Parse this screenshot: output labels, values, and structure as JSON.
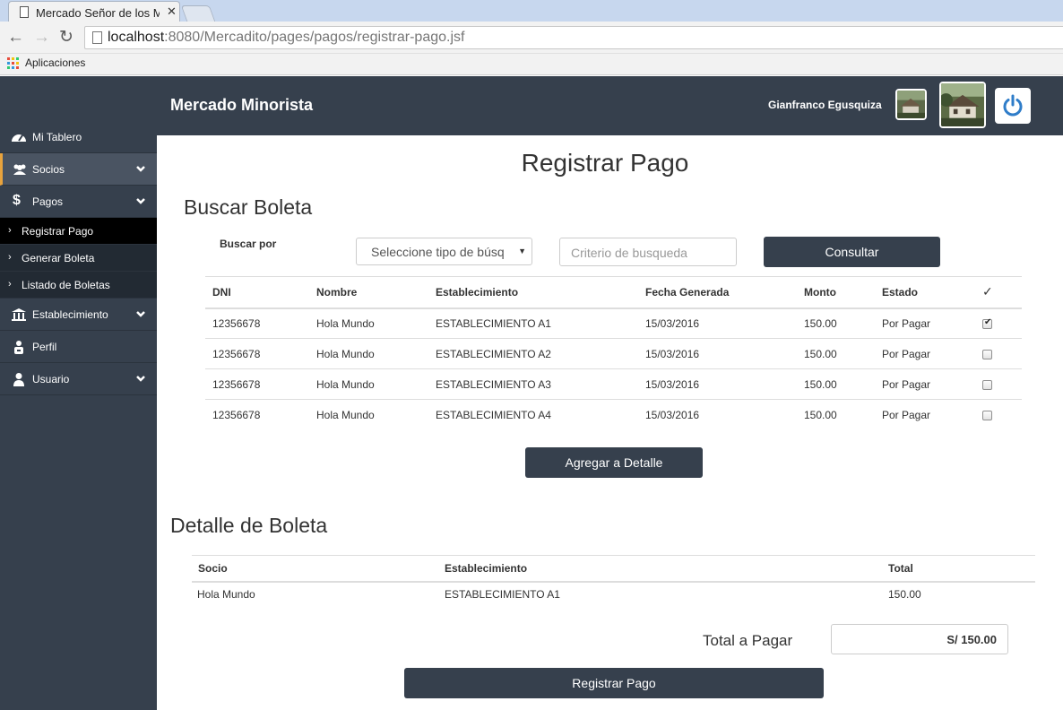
{
  "browser": {
    "tab_title": "Mercado Señor de los Mil",
    "url_host": "localhost",
    "url_path": ":8080/Mercadito/pages/pagos/registrar-pago.jsf",
    "bookmark_apps": "Aplicaciones"
  },
  "header": {
    "brand": "Mercado Minorista",
    "user_name": "Gianfranco  Egusquiza"
  },
  "sidebar": {
    "items": [
      {
        "label": "Mi Tablero",
        "icon": "dashboard-icon"
      },
      {
        "label": "Socios",
        "icon": "users-icon"
      },
      {
        "label": "Pagos",
        "icon": "dollar-icon"
      },
      {
        "label": "Establecimiento",
        "icon": "bank-icon"
      },
      {
        "label": "Perfil",
        "icon": "profile-icon"
      },
      {
        "label": "Usuario",
        "icon": "user-icon"
      }
    ],
    "pagos_sub": [
      {
        "label": "Registrar Pago"
      },
      {
        "label": "Generar Boleta"
      },
      {
        "label": "Listado de Boletas"
      }
    ]
  },
  "main": {
    "page_title": "Registrar Pago",
    "buscar_title": "Buscar Boleta",
    "buscar_por_label": "Buscar por",
    "select_value": "Seleccione tipo de búsq",
    "search_placeholder": "Criterio de busqueda",
    "consultar_label": "Consultar",
    "boletas_table": {
      "headers": [
        "DNI",
        "Nombre",
        "Establecimiento",
        "Fecha Generada",
        "Monto",
        "Estado",
        "✓"
      ],
      "rows": [
        {
          "dni": "12356678",
          "nombre": "Hola Mundo",
          "establecimiento": "ESTABLECIMIENTO A1",
          "fecha": "15/03/2016",
          "monto": "150.00",
          "estado": "Por Pagar",
          "checked": true
        },
        {
          "dni": "12356678",
          "nombre": "Hola Mundo",
          "establecimiento": "ESTABLECIMIENTO A2",
          "fecha": "15/03/2016",
          "monto": "150.00",
          "estado": "Por Pagar",
          "checked": false
        },
        {
          "dni": "12356678",
          "nombre": "Hola Mundo",
          "establecimiento": "ESTABLECIMIENTO A3",
          "fecha": "15/03/2016",
          "monto": "150.00",
          "estado": "Por Pagar",
          "checked": false
        },
        {
          "dni": "12356678",
          "nombre": "Hola Mundo",
          "establecimiento": "ESTABLECIMIENTO A4",
          "fecha": "15/03/2016",
          "monto": "150.00",
          "estado": "Por Pagar",
          "checked": false
        }
      ]
    },
    "agregar_label": "Agregar a Detalle",
    "detalle_title": "Detalle de Boleta",
    "detalle_table": {
      "headers": [
        "Socio",
        "Establecimiento",
        "Total"
      ],
      "rows": [
        {
          "socio": "Hola Mundo",
          "establecimiento": "ESTABLECIMIENTO A1",
          "total": "150.00"
        }
      ]
    },
    "total_label": "Total a Pagar",
    "total_value": "S/ 150.00",
    "registrar_label": "Registrar Pago"
  },
  "colors": {
    "navbar": "#36404d",
    "sidebar_active_accent": "#e8a33d",
    "submenu_bg": "#222a33",
    "power_icon": "#2f7dc9"
  }
}
